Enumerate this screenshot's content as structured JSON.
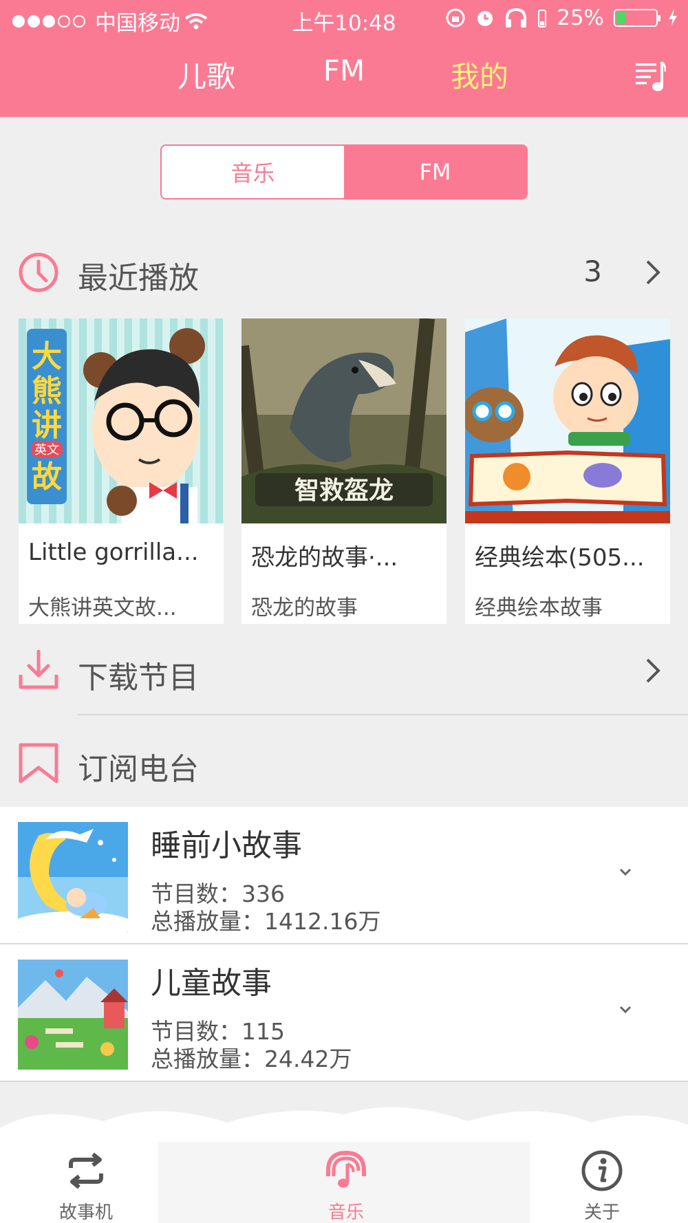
{
  "status_bar": {
    "carrier": "中国移动",
    "time": "上午10:48",
    "battery": "25%"
  },
  "top_nav": {
    "tabs": [
      {
        "label": "儿歌",
        "active": false
      },
      {
        "label": "FM",
        "active": false
      },
      {
        "label": "我的",
        "active": true
      }
    ]
  },
  "segment": {
    "options": [
      {
        "label": "音乐",
        "active": false
      },
      {
        "label": "FM",
        "active": true
      }
    ]
  },
  "recent": {
    "title": "最近播放",
    "count": "3",
    "items": [
      {
        "title": "Little gorrilla...",
        "subtitle": "大熊讲英文故..."
      },
      {
        "title": "恐龙的故事·...",
        "subtitle": "恐龙的故事"
      },
      {
        "title": "经典绘本(505...",
        "subtitle": "经典绘本故事"
      }
    ]
  },
  "artwork": {
    "card1_text": "大熊讲英文故事",
    "card2_text": "智救盔龙"
  },
  "downloads": {
    "title": "下载节目"
  },
  "subscriptions": {
    "title": "订阅电台",
    "items": [
      {
        "name": "睡前小故事",
        "count_label": "节目数：",
        "count": "336",
        "plays_label": "总播放量：",
        "plays": "1412.16万"
      },
      {
        "name": "儿童故事",
        "count_label": "节目数：",
        "count": "115",
        "plays_label": "总播放量：",
        "plays": "24.42万"
      }
    ]
  },
  "bottom_bar": {
    "items": [
      {
        "label": "故事机",
        "icon": "repeat-icon",
        "active": false
      },
      {
        "label": "音乐",
        "icon": "headphones-icon",
        "active": true
      },
      {
        "label": "关于",
        "icon": "info-icon",
        "active": false
      }
    ]
  },
  "colors": {
    "accent": "#fb7a93",
    "active_tab": "#fff27a",
    "background": "#efefef"
  }
}
